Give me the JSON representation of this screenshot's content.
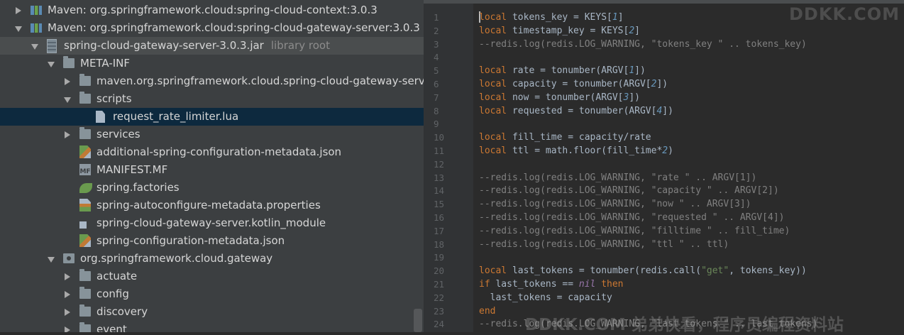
{
  "tree": {
    "rows": [
      {
        "label": "Maven: org.springframework.cloud:spring-cloud-context:3.0.3",
        "hint": "",
        "icon": "maven-library-icon",
        "arrow": "right",
        "indent": 0,
        "state": ""
      },
      {
        "label": "Maven: org.springframework.cloud:spring-cloud-gateway-server:3.0.3",
        "hint": "",
        "icon": "maven-library-icon",
        "arrow": "down",
        "indent": 0,
        "state": ""
      },
      {
        "label": "spring-cloud-gateway-server-3.0.3.jar",
        "hint": "library root",
        "icon": "jar-icon",
        "arrow": "down",
        "indent": 1,
        "state": "jar"
      },
      {
        "label": "META-INF",
        "hint": "",
        "icon": "folder-icon",
        "arrow": "down",
        "indent": 2,
        "state": ""
      },
      {
        "label": "maven.org.springframework.cloud.spring-cloud-gateway-server",
        "hint": "",
        "icon": "folder-icon",
        "arrow": "right",
        "indent": 3,
        "state": ""
      },
      {
        "label": "scripts",
        "hint": "",
        "icon": "folder-icon",
        "arrow": "down",
        "indent": 3,
        "state": ""
      },
      {
        "label": "request_rate_limiter.lua",
        "hint": "",
        "icon": "lua-file-icon",
        "arrow": "",
        "indent": 4,
        "state": "sel"
      },
      {
        "label": "services",
        "hint": "",
        "icon": "folder-icon",
        "arrow": "right",
        "indent": 3,
        "state": ""
      },
      {
        "label": "additional-spring-configuration-metadata.json",
        "hint": "",
        "icon": "json-file-icon",
        "arrow": "",
        "indent": 3,
        "state": ""
      },
      {
        "label": "MANIFEST.MF",
        "hint": "",
        "icon": "manifest-file-icon",
        "arrow": "",
        "indent": 3,
        "state": ""
      },
      {
        "label": "spring.factories",
        "hint": "",
        "icon": "spring-factories-icon",
        "arrow": "",
        "indent": 3,
        "state": ""
      },
      {
        "label": "spring-autoconfigure-metadata.properties",
        "hint": "",
        "icon": "properties-file-icon",
        "arrow": "",
        "indent": 3,
        "state": ""
      },
      {
        "label": "spring-cloud-gateway-server.kotlin_module",
        "hint": "",
        "icon": "kotlin-module-icon",
        "arrow": "",
        "indent": 3,
        "state": ""
      },
      {
        "label": "spring-configuration-metadata.json",
        "hint": "",
        "icon": "json-file-icon",
        "arrow": "",
        "indent": 3,
        "state": ""
      },
      {
        "label": "org.springframework.cloud.gateway",
        "hint": "",
        "icon": "package-icon",
        "arrow": "down",
        "indent": 2,
        "state": ""
      },
      {
        "label": "actuate",
        "hint": "",
        "icon": "folder-icon",
        "arrow": "right",
        "indent": 3,
        "state": ""
      },
      {
        "label": "config",
        "hint": "",
        "icon": "folder-icon",
        "arrow": "right",
        "indent": 3,
        "state": ""
      },
      {
        "label": "discovery",
        "hint": "",
        "icon": "folder-icon",
        "arrow": "right",
        "indent": 3,
        "state": ""
      },
      {
        "label": "event",
        "hint": "",
        "icon": "folder-icon",
        "arrow": "right",
        "indent": 3,
        "state": ""
      }
    ]
  },
  "editor": {
    "line_numbers": [
      "1",
      "2",
      "3",
      "4",
      "5",
      "6",
      "7",
      "8",
      "9",
      "10",
      "11",
      "12",
      "13",
      "14",
      "15",
      "16",
      "17",
      "18",
      "19",
      "20",
      "21",
      "22",
      "23",
      "24"
    ],
    "lines": [
      [
        [
          "kw",
          "local"
        ],
        [
          "txt",
          " tokens_key = KEYS["
        ],
        [
          "num",
          "1"
        ],
        [
          "txt",
          "]"
        ]
      ],
      [
        [
          "kw",
          "local"
        ],
        [
          "txt",
          " timestamp_key = KEYS["
        ],
        [
          "num",
          "2"
        ],
        [
          "txt",
          "]"
        ]
      ],
      [
        [
          "cm",
          "--redis.log(redis.LOG_WARNING, \"tokens_key \" .. tokens_key)"
        ]
      ],
      [],
      [
        [
          "kw",
          "local"
        ],
        [
          "txt",
          " rate = tonumber(ARGV["
        ],
        [
          "num",
          "1"
        ],
        [
          "txt",
          "])"
        ]
      ],
      [
        [
          "kw",
          "local"
        ],
        [
          "txt",
          " capacity = tonumber(ARGV["
        ],
        [
          "num",
          "2"
        ],
        [
          "txt",
          "])"
        ]
      ],
      [
        [
          "kw",
          "local"
        ],
        [
          "txt",
          " now = tonumber(ARGV["
        ],
        [
          "num",
          "3"
        ],
        [
          "txt",
          "])"
        ]
      ],
      [
        [
          "kw",
          "local"
        ],
        [
          "txt",
          " requested = tonumber(ARGV["
        ],
        [
          "num",
          "4"
        ],
        [
          "txt",
          "])"
        ]
      ],
      [],
      [
        [
          "kw",
          "local"
        ],
        [
          "txt",
          " fill_time = capacity/rate"
        ]
      ],
      [
        [
          "kw",
          "local"
        ],
        [
          "txt",
          " ttl = math.floor(fill_time*"
        ],
        [
          "num",
          "2"
        ],
        [
          "txt",
          ")"
        ]
      ],
      [],
      [
        [
          "cm",
          "--redis.log(redis.LOG_WARNING, \"rate \" .. ARGV[1])"
        ]
      ],
      [
        [
          "cm",
          "--redis.log(redis.LOG_WARNING, \"capacity \" .. ARGV[2])"
        ]
      ],
      [
        [
          "cm",
          "--redis.log(redis.LOG_WARNING, \"now \" .. ARGV[3])"
        ]
      ],
      [
        [
          "cm",
          "--redis.log(redis.LOG_WARNING, \"requested \" .. ARGV[4])"
        ]
      ],
      [
        [
          "cm",
          "--redis.log(redis.LOG_WARNING, \"filltime \" .. fill_time)"
        ]
      ],
      [
        [
          "cm",
          "--redis.log(redis.LOG_WARNING, \"ttl \" .. ttl)"
        ]
      ],
      [],
      [
        [
          "kw",
          "local"
        ],
        [
          "txt",
          " last_tokens = tonumber(redis.call("
        ],
        [
          "str",
          "\"get\""
        ],
        [
          "txt",
          ", tokens_key))"
        ]
      ],
      [
        [
          "kw",
          "if"
        ],
        [
          "txt",
          " last_tokens == "
        ],
        [
          "nil",
          "nil"
        ],
        [
          "txt",
          " "
        ],
        [
          "kw",
          "then"
        ]
      ],
      [
        [
          "txt",
          "  last_tokens = capacity"
        ]
      ],
      [
        [
          "kw",
          "end"
        ]
      ],
      [
        [
          "cm",
          "--redis.log(redis.LOG_WARNING, \"last_tokens \" .. last_tokens)"
        ]
      ]
    ]
  },
  "watermarks": {
    "top": "DDKK.COM",
    "bottom": "DDKK.COM 弟弟快看，程序员编程资料站"
  }
}
